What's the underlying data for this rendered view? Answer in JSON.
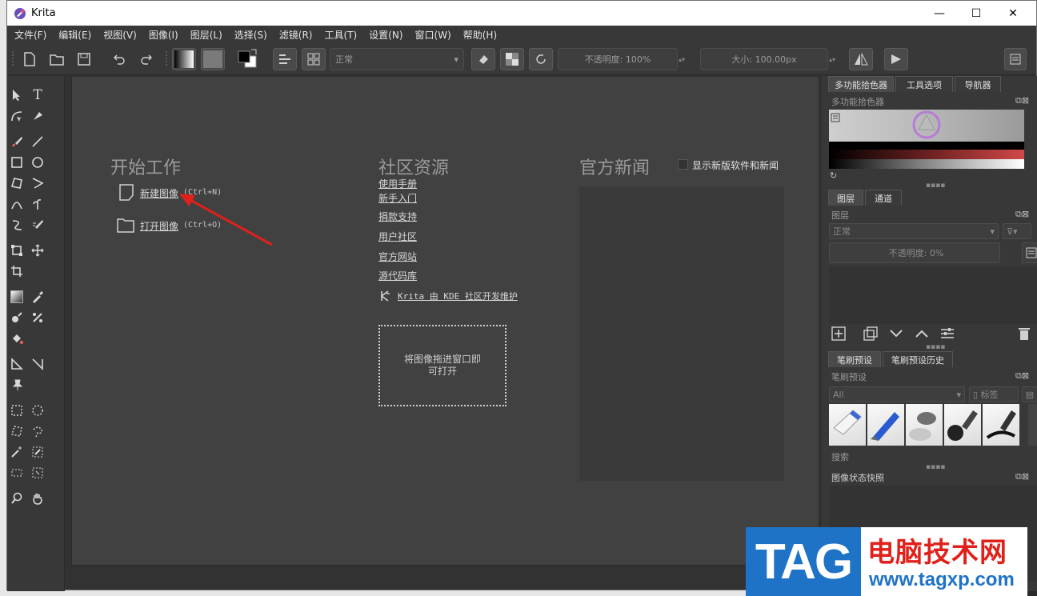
{
  "window": {
    "title": "Krita",
    "minimize_glyph": "—",
    "maximize_glyph": "☐",
    "close_glyph": "✕"
  },
  "menu": [
    "文件(F)",
    "编辑(E)",
    "视图(V)",
    "图像(I)",
    "图层(L)",
    "选择(S)",
    "滤镜(R)",
    "工具(T)",
    "设置(N)",
    "窗口(W)",
    "帮助(H)"
  ],
  "toolbar": {
    "blend_mode": "正常",
    "opacity": "不透明度: 100%",
    "size": "大小: 100.00px"
  },
  "welcome": {
    "start_title": "开始工作",
    "new_image": "新建图像",
    "new_image_shortcut": "(Ctrl+N)",
    "open_image": "打开图像",
    "open_image_shortcut": "(Ctrl+O)",
    "community_title": "社区资源",
    "community_links": [
      "使用手册",
      "新手入门",
      "捐款支持",
      "用户社区",
      "官方网站",
      "源代码库"
    ],
    "kde_credit": "Krita 由 KDE 社区开发维护",
    "dropzone_line1": "将图像拖进窗口即",
    "dropzone_line2": "可打开",
    "news_title": "官方新闻",
    "news_checkbox_label": "显示新版软件和新闻"
  },
  "dock": {
    "top_tabs": [
      "多功能拾色器",
      "工具选项",
      "导航器"
    ],
    "color_selector_label": "多功能拾色器",
    "layer_tabs": [
      "图层",
      "通道"
    ],
    "layers_label": "图层",
    "layer_blend": "正常",
    "layer_opacity": "不透明度:  0%",
    "brush_tabs": [
      "笔刷预设",
      "笔刷预设历史"
    ],
    "brush_label": "笔刷预设",
    "brush_filter": "All",
    "brush_tag": "标签",
    "search_label": "搜索",
    "snapshot_label": "图像状态快照"
  },
  "watermark": {
    "tag": "TAG",
    "cn": "电脑技术网",
    "url": "www.tagxp.com"
  },
  "colors": {
    "accent_red": "#e0201b",
    "watermark_blue": "#1f73c7"
  }
}
